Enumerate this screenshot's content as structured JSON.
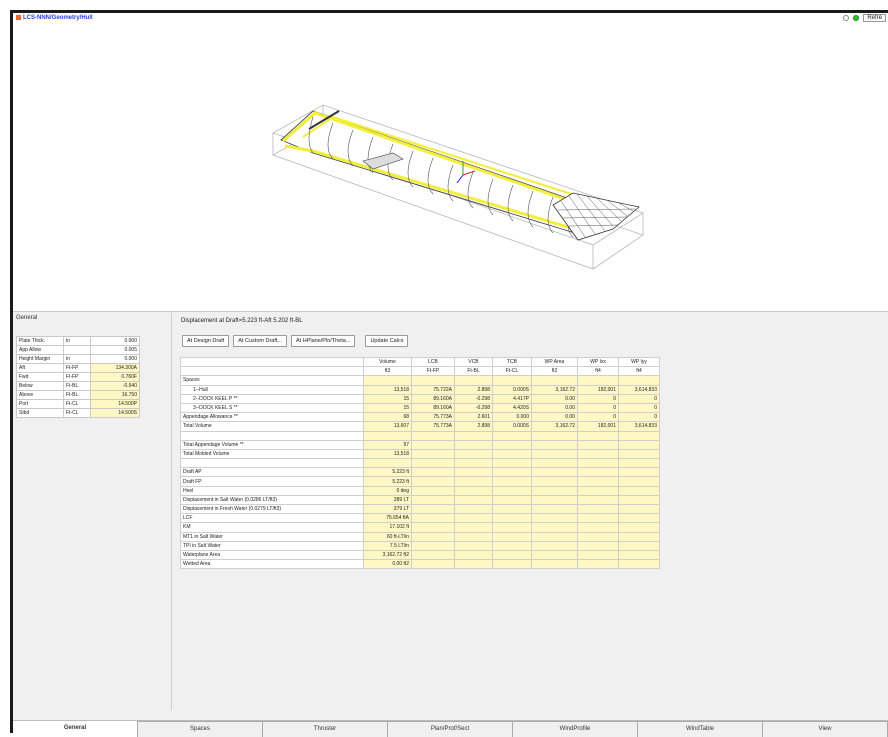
{
  "window": {
    "title": "LCS-NNN/Geometry/Hull",
    "toolbar_button": "Refre"
  },
  "colors": {
    "highlight_yellow": "#fff8c4",
    "hull_yellow": "#f2ee3a",
    "title_blue": "#2b3fd6"
  },
  "general": {
    "title": "General",
    "rows": [
      {
        "label": "Plate Thick.",
        "unit": "in",
        "value": "0.000",
        "highlight": false
      },
      {
        "label": "App Allow",
        "unit": "",
        "value": "0.005",
        "highlight": false
      },
      {
        "label": "Height Margin",
        "unit": "in",
        "value": "0.000",
        "highlight": false
      },
      {
        "label": "Aft",
        "unit": "Ft-FP",
        "value": "134.300A",
        "highlight": true
      },
      {
        "label": "Fwd",
        "unit": "Ft-FP",
        "value": "0.760F",
        "highlight": true
      },
      {
        "label": "Below",
        "unit": "Ft-BL",
        "value": "-0.540",
        "highlight": true
      },
      {
        "label": "Above",
        "unit": "Ft-BL",
        "value": "16.750",
        "highlight": true
      },
      {
        "label": "Port",
        "unit": "Ft-CL",
        "value": "14.500P",
        "highlight": true
      },
      {
        "label": "Stbd",
        "unit": "Ft-CL",
        "value": "14.500S",
        "highlight": true
      }
    ]
  },
  "displacement": {
    "title": "Displacement at Draft=5.223 ft-Aft 5.202 ft-BL",
    "buttons": [
      "At Design Draft",
      "At Custom Draft...",
      "At HPlane/Pln/Theta...",
      "Update Calcs"
    ],
    "headers": [
      "Volume",
      "LCB",
      "VCB",
      "TCB",
      "WP Area",
      "WP Ixx",
      "WP Iyy"
    ],
    "units": [
      "ft3",
      "Ft-FP",
      "Ft-BL",
      "Ft-CL",
      "ft2",
      "ft4",
      "ft4"
    ],
    "rows": [
      {
        "label": "Spaces",
        "indent": false,
        "cells": [
          "",
          "",
          "",
          "",
          "",
          "",
          ""
        ]
      },
      {
        "label": "1--Hull",
        "indent": true,
        "cells": [
          "13,518",
          "75.722A",
          "2.898",
          "0.000S",
          "3,162.72",
          "182,001",
          "3,614,833"
        ]
      },
      {
        "label": "2--DOCK KEEL P **",
        "indent": true,
        "cells": [
          "15",
          "89.160A",
          "-0.298",
          "4.417P",
          "0.00",
          "0",
          "0"
        ]
      },
      {
        "label": "3--DOCK KEEL S **",
        "indent": true,
        "cells": [
          "15",
          "89.160A",
          "-0.298",
          "4.420S",
          "0.00",
          "0",
          "0"
        ]
      },
      {
        "label": "Appendage Allowance **",
        "indent": false,
        "cells": [
          "68",
          "75.773A",
          "2.601",
          "0.000",
          "0.00",
          "0",
          "0"
        ]
      },
      {
        "label": "Total Volume",
        "indent": false,
        "cells": [
          "13,607",
          "75.773A",
          "2.898",
          "0.000S",
          "3,162.72",
          "182,001",
          "3,614,833"
        ]
      },
      {
        "label": "",
        "indent": false,
        "blank": true,
        "cells": [
          "",
          "",
          "",
          "",
          "",
          "",
          ""
        ]
      },
      {
        "label": "Total Appendage Volume **",
        "indent": false,
        "cells": [
          "97",
          "",
          "",
          "",
          "",
          "",
          ""
        ]
      },
      {
        "label": "Total Molded Volume",
        "indent": false,
        "cells": [
          "13,518",
          "",
          "",
          "",
          "",
          "",
          ""
        ]
      },
      {
        "label": "",
        "indent": false,
        "blank": true,
        "cells": [
          "",
          "",
          "",
          "",
          "",
          "",
          ""
        ]
      },
      {
        "label": "Draft AP",
        "indent": false,
        "cells": [
          "5.223 ft",
          "",
          "",
          "",
          "",
          "",
          ""
        ]
      },
      {
        "label": "Draft FP",
        "indent": false,
        "cells": [
          "5.223 ft",
          "",
          "",
          "",
          "",
          "",
          ""
        ]
      },
      {
        "label": "Heel",
        "indent": false,
        "cells": [
          "0 deg",
          "",
          "",
          "",
          "",
          "",
          ""
        ]
      },
      {
        "label": "Displacement in Salt Water (0.0286 LT/ft3)",
        "indent": false,
        "cells": [
          "389 LT",
          "",
          "",
          "",
          "",
          "",
          ""
        ]
      },
      {
        "label": "Displacement in Fresh Water (0.0279 LT/ft3)",
        "indent": false,
        "cells": [
          "379 LT",
          "",
          "",
          "",
          "",
          "",
          ""
        ]
      },
      {
        "label": "LCF",
        "indent": false,
        "cells": [
          "75.654 ftA",
          "",
          "",
          "",
          "",
          "",
          ""
        ]
      },
      {
        "label": "KM",
        "indent": false,
        "cells": [
          "17.102 ft",
          "",
          "",
          "",
          "",
          "",
          ""
        ]
      },
      {
        "label": "MT1 in Salt Water",
        "indent": false,
        "cells": [
          "60 ft-LT/in",
          "",
          "",
          "",
          "",
          "",
          ""
        ]
      },
      {
        "label": "TPI in Salt Water",
        "indent": false,
        "cells": [
          "7.5 LT/in",
          "",
          "",
          "",
          "",
          "",
          ""
        ]
      },
      {
        "label": "Waterplane Area",
        "indent": false,
        "cells": [
          "3,162.72 ft2",
          "",
          "",
          "",
          "",
          "",
          ""
        ]
      },
      {
        "label": "Wetted Area",
        "indent": false,
        "cells": [
          "0.00 ft2",
          "",
          "",
          "",
          "",
          "",
          ""
        ]
      }
    ]
  },
  "tabs": [
    {
      "label": "General",
      "active": true
    },
    {
      "label": "Spaces",
      "active": false
    },
    {
      "label": "Thruster",
      "active": false
    },
    {
      "label": "Plan/Prof/Sect",
      "active": false
    },
    {
      "label": "WindProfile",
      "active": false
    },
    {
      "label": "WindTable",
      "active": false
    },
    {
      "label": "View",
      "active": false
    }
  ]
}
